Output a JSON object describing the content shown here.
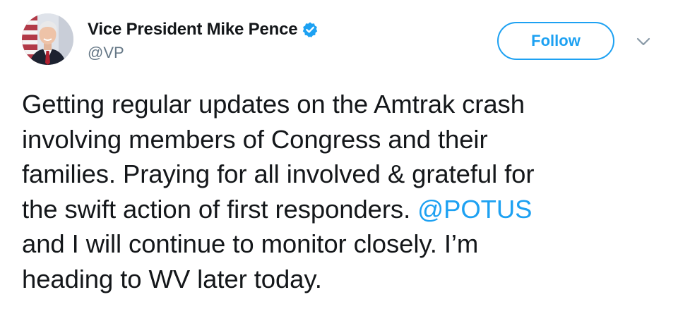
{
  "author": {
    "display_name": "Vice President Mike Pence",
    "handle": "@VP",
    "verified": true
  },
  "follow_button": {
    "label": "Follow"
  },
  "tweet": {
    "lines": [
      "Getting regular updates on the Amtrak crash",
      "involving members of Congress and their",
      "families. Praying for all involved & grateful for"
    ],
    "line4_text": "the swift action of first responders. ",
    "mention": "@POTUS",
    "lines_after": [
      "and I will continue to monitor closely. I’m",
      "heading to WV later today."
    ]
  },
  "icons": {
    "verified": "verified-badge-icon",
    "caret": "chevron-down-icon",
    "avatar": "profile-photo"
  },
  "colors": {
    "text": "#14171a",
    "secondary": "#657786",
    "accent": "#1da1f2"
  }
}
